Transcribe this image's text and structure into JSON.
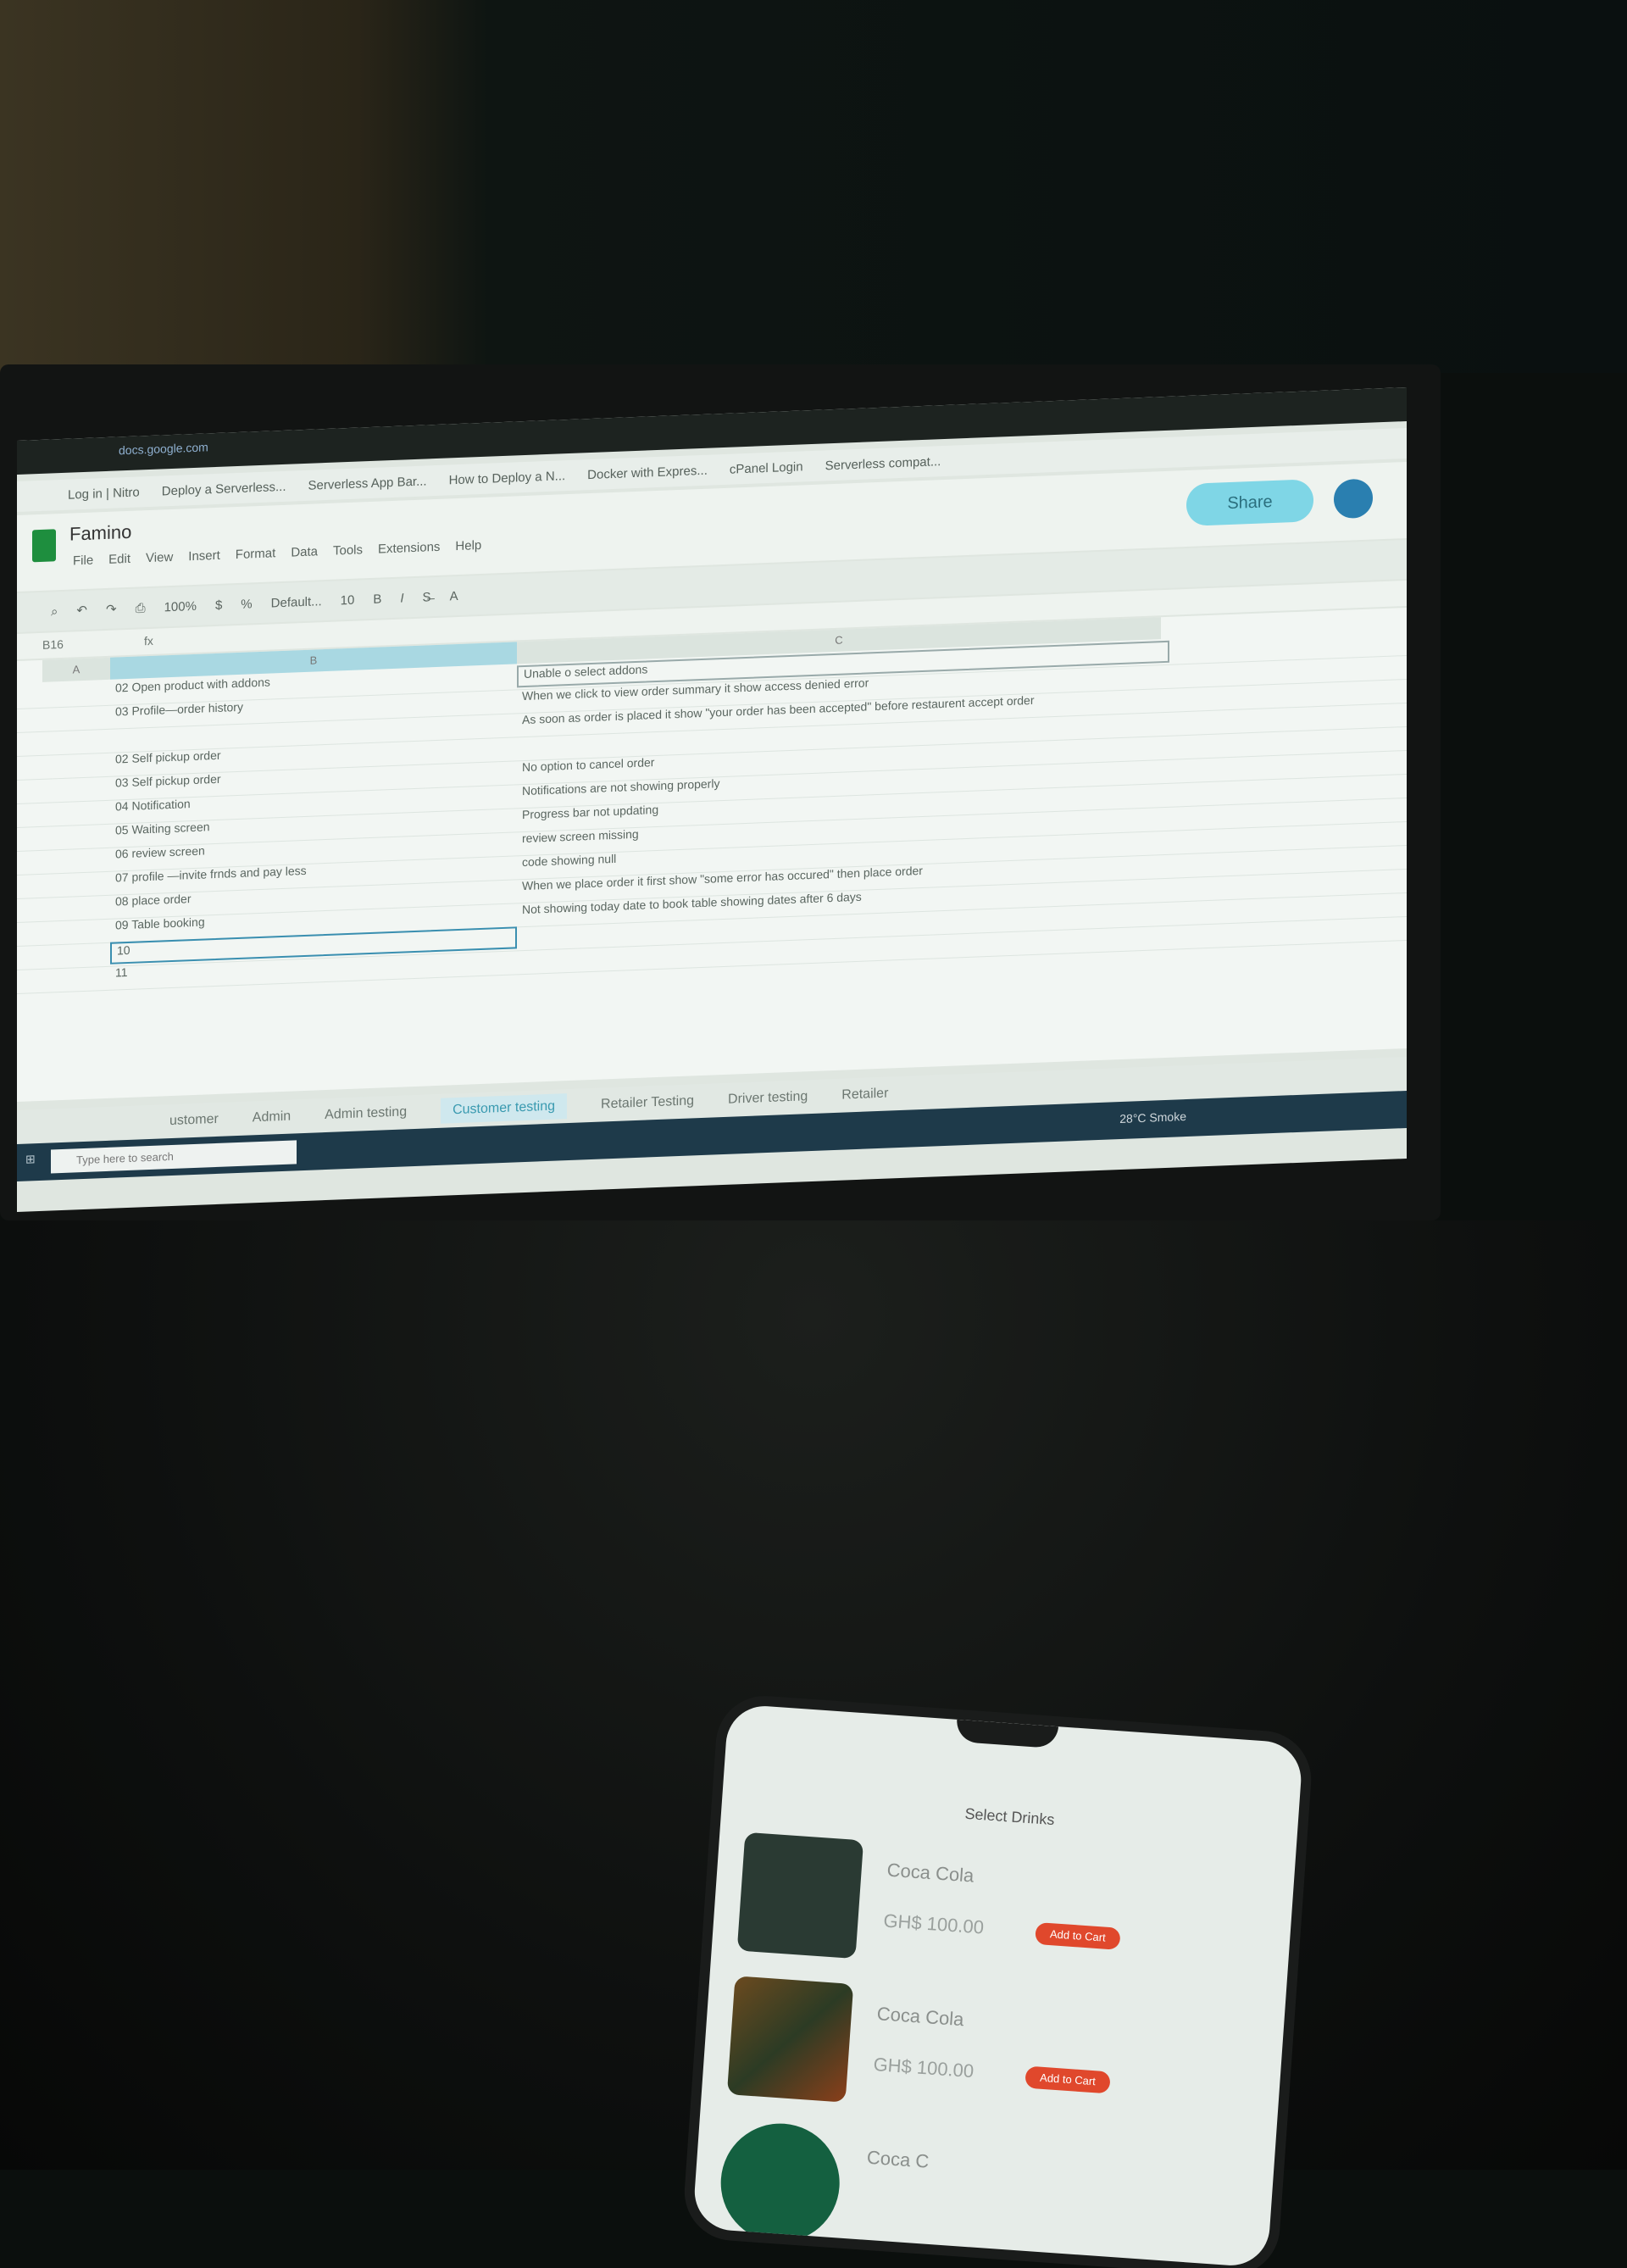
{
  "spreadsheet": {
    "url": "docs.google.com",
    "title": "Famino",
    "share_label": "Share",
    "menu": [
      "File",
      "Edit",
      "View",
      "Insert",
      "Format",
      "Data",
      "Tools",
      "Extensions",
      "Help"
    ],
    "bookmarks": [
      "Log in | Nitro",
      "Deploy a Serverless...",
      "Serverless App Bar...",
      "How to Deploy a N...",
      "Docker with Expres...",
      "cPanel Login",
      "Serverless compat..."
    ],
    "toolbar": {
      "zoom": "100%",
      "font": "Default...",
      "font_size": "10",
      "currency": "$",
      "percent": "%"
    },
    "name_box": "B16",
    "columns": {
      "a": "A",
      "b": "B",
      "c": "C"
    },
    "rows": [
      {
        "b": "02 Open product with addons",
        "c": "Unable o select addons"
      },
      {
        "b": "03 Profile—order history",
        "c": "When we click to view order summary it show access denied error"
      },
      {
        "b": "",
        "c": "As soon as order is placed it show \"your order has been accepted\" before restaurent accept order"
      },
      {
        "b": "02 Self pickup order",
        "c": ""
      },
      {
        "b": "03 Self pickup order",
        "c": "No option to cancel order"
      },
      {
        "b": "04 Notification",
        "c": "Notifications are not showing properly"
      },
      {
        "b": "05 Waiting screen",
        "c": "Progress bar not updating"
      },
      {
        "b": "06 review screen",
        "c": "review screen missing"
      },
      {
        "b": "07 profile —invite frnds and pay less",
        "c": "code showing null"
      },
      {
        "b": "08 place order",
        "c": "When we place order it first show \"some error has occured\" then place order"
      },
      {
        "b": "09 Table booking",
        "c": "Not showing today date to book table showing dates after 6 days"
      },
      {
        "b": "10",
        "c": ""
      },
      {
        "b": "11",
        "c": ""
      }
    ],
    "tabs": [
      "ustomer",
      "Admin",
      "Admin testing",
      "Customer testing",
      "Retailer Testing",
      "Driver testing",
      "Retailer"
    ],
    "active_tab": "Customer testing"
  },
  "taskbar": {
    "search_placeholder": "Type here to search",
    "weather": "28°C Smoke"
  },
  "phone": {
    "title": "Select Drinks",
    "items": [
      {
        "name": "Coca Cola",
        "price": "GH$ 100.00",
        "button": "Add to Cart"
      },
      {
        "name": "Coca Cola",
        "price": "GH$ 100.00",
        "button": "Add to Cart"
      },
      {
        "name": "Coca C",
        "price": "",
        "button": ""
      }
    ]
  }
}
